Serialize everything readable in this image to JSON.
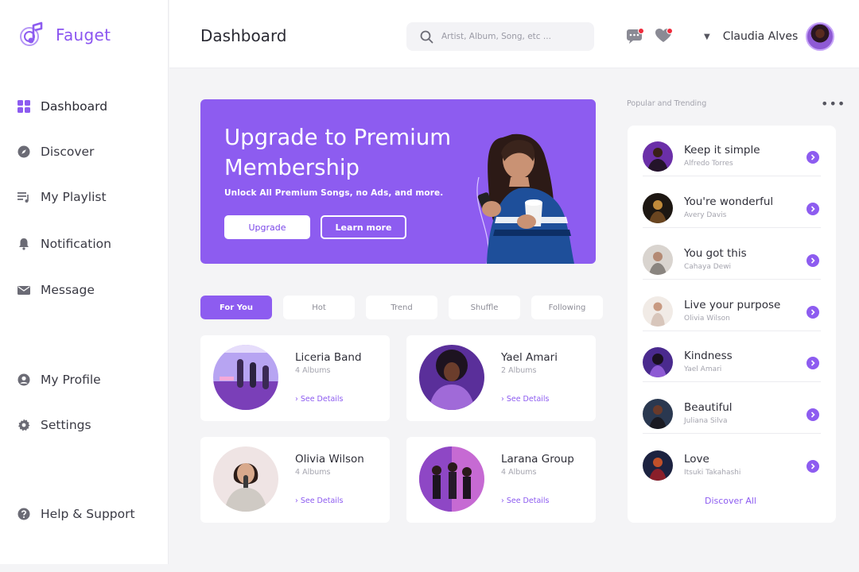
{
  "brand": {
    "name": "Fauget",
    "accent": "#8d5cf0"
  },
  "sidebar": {
    "items": [
      {
        "label": "Dashboard",
        "icon": "grid-icon"
      },
      {
        "label": "Discover",
        "icon": "compass-icon"
      },
      {
        "label": "My Playlist",
        "icon": "playlist-icon"
      },
      {
        "label": "Notification",
        "icon": "bell-icon"
      },
      {
        "label": "Message",
        "icon": "envelope-icon"
      },
      {
        "label": "My Profile",
        "icon": "user-circle-icon"
      },
      {
        "label": "Settings",
        "icon": "gear-icon"
      },
      {
        "label": "Help & Support",
        "icon": "help-icon"
      }
    ]
  },
  "header": {
    "title": "Dashboard",
    "search_placeholder": "Artist, Album, Song, etc ...",
    "user_name": "Claudia Alves"
  },
  "banner": {
    "title": "Upgrade to Premium Membership",
    "subtitle": "Unlock All Premium Songs, no Ads, and more.",
    "upgrade_label": "Upgrade",
    "learn_more_label": "Learn more"
  },
  "tabs": [
    "For You",
    "Hot",
    "Trend",
    "Shuffle",
    "Following"
  ],
  "artists": [
    {
      "name": "Liceria Band",
      "albums": "4 Albums",
      "details": "› See Details"
    },
    {
      "name": "Yael Amari",
      "albums": "2 Albums",
      "details": "› See Details"
    },
    {
      "name": "Olivia Wilson",
      "albums": "4 Albums",
      "details": "› See Details"
    },
    {
      "name": "Larana Group",
      "albums": "4 Albums",
      "details": "› See Details"
    }
  ],
  "trending": {
    "heading": "Popular and Trending",
    "discover_all": "Discover All",
    "songs": [
      {
        "title": "Keep it simple",
        "artist": "Alfredo Torres"
      },
      {
        "title": "You're wonderful",
        "artist": "Avery Davis"
      },
      {
        "title": "You got this",
        "artist": "Cahaya Dewi"
      },
      {
        "title": "Live your purpose",
        "artist": "Olivia Wilson"
      },
      {
        "title": "Kindness",
        "artist": "Yael Amari"
      },
      {
        "title": "Beautiful",
        "artist": "Juliana Silva"
      },
      {
        "title": "Love",
        "artist": "Itsuki Takahashi"
      }
    ]
  }
}
